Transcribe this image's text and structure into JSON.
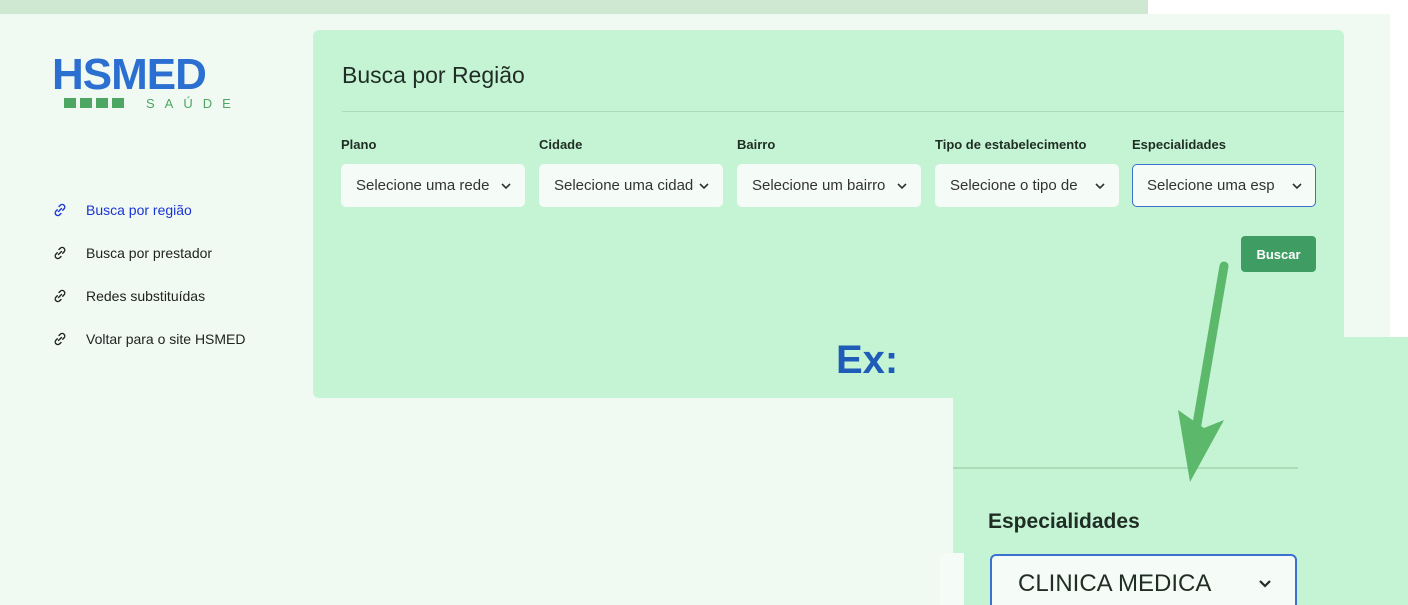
{
  "logo": {
    "word": "HSMED",
    "sub": "SAÚDE"
  },
  "nav": {
    "items": [
      {
        "label": "Busca por região",
        "active": true
      },
      {
        "label": "Busca por prestador",
        "active": false
      },
      {
        "label": "Redes substituídas",
        "active": false
      },
      {
        "label": "Voltar para o site HSMED",
        "active": false
      }
    ]
  },
  "card": {
    "title": "Busca por Região",
    "fields": [
      {
        "label": "Plano",
        "placeholder": "Selecione uma rede"
      },
      {
        "label": "Cidade",
        "placeholder": "Selecione uma cidade"
      },
      {
        "label": "Bairro",
        "placeholder": "Selecione um bairro"
      },
      {
        "label": "Tipo de estabelecimento",
        "placeholder": "Selecione o tipo de"
      },
      {
        "label": "Especialidades",
        "placeholder": "Selecione uma esp"
      }
    ],
    "search_button": "Buscar"
  },
  "example": {
    "label": "Ex:",
    "field_label": "Especialidades",
    "selected_value": "CLINICA MEDICA"
  },
  "colors": {
    "accent_blue": "#2b6fd0",
    "accent_green": "#3f9c63",
    "card_bg": "#c5f4d4",
    "active_link": "#1a33d6"
  }
}
